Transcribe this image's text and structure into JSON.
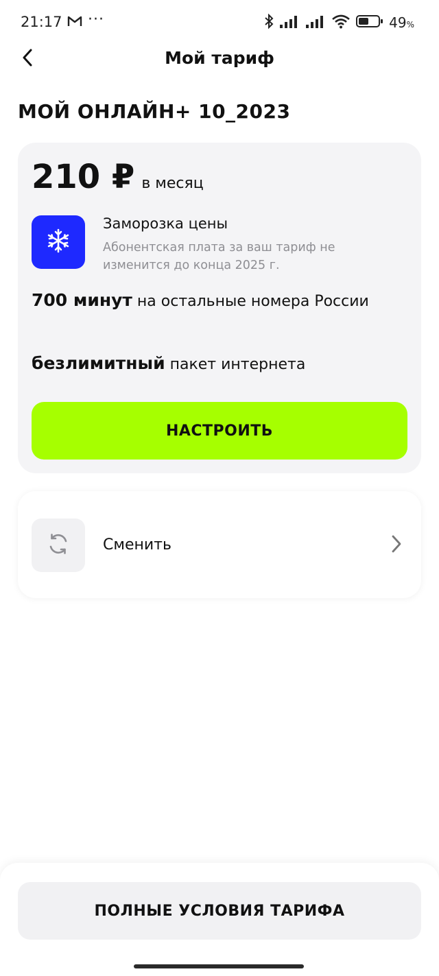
{
  "status_bar": {
    "time": "21:17",
    "battery_percent": "49",
    "battery_percent_sign": "%",
    "icons": [
      "mail-icon",
      "more-dots-icon",
      "bluetooth-icon",
      "signal-icon",
      "signal-icon",
      "wifi-icon",
      "battery-icon"
    ]
  },
  "header": {
    "title": "Мой тариф",
    "back_icon": "chevron-left-icon"
  },
  "tariff": {
    "name": "МОЙ ОНЛАЙН+ 10_2023",
    "price": "210 ₽",
    "period": "в месяц",
    "freeze": {
      "icon": "snowflake-icon",
      "title": "Заморозка цены",
      "description": "Абонентская плата за ваш тариф не изменится до конца 2025 г."
    },
    "features": [
      {
        "bold": "700 минут",
        "text": " на остальные номера России"
      },
      {
        "bold": "безлимитный",
        "text": " пакет интернета"
      }
    ],
    "configure_label": "НАСТРОИТЬ"
  },
  "change": {
    "icon": "refresh-icon",
    "label": "Сменить",
    "chevron": "chevron-right-icon"
  },
  "bottom": {
    "full_terms_label": "ПОЛНЫЕ УСЛОВИЯ ТАРИФА"
  },
  "colors": {
    "accent_green": "#a6ff00",
    "freeze_blue": "#1e29ff",
    "card_bg": "#f4f4f6",
    "secondary_text": "#8e8e93"
  }
}
